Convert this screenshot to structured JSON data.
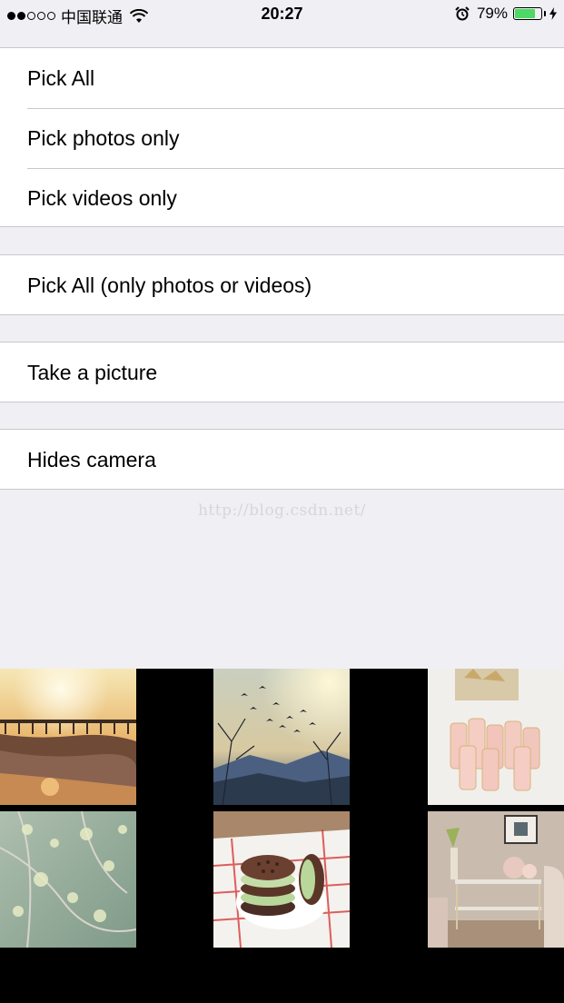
{
  "status_bar": {
    "carrier": "中国联通",
    "time": "20:27",
    "battery_percent": "79%",
    "battery_level": 0.79,
    "signal_bars_filled": 2,
    "signal_bars_total": 5
  },
  "menu": {
    "group1": {
      "pick_all": "Pick All",
      "pick_photos_only": "Pick photos only",
      "pick_videos_only": "Pick videos only"
    },
    "group2": {
      "pick_all_exclusive": "Pick All (only photos or videos)"
    },
    "group3": {
      "take_picture": "Take a picture"
    },
    "group4": {
      "hides_camera": "Hides camera"
    }
  },
  "watermark": "http://blog.csdn.net/",
  "photos": [
    {
      "subject": "sunset-pier"
    },
    {
      "subject": "birds-sky"
    },
    {
      "subject": "champagne-glasses"
    },
    {
      "subject": "blossom-branches"
    },
    {
      "subject": "ice-cream-sandwich"
    },
    {
      "subject": "living-room"
    }
  ],
  "colors": {
    "background": "#efeff4",
    "separator": "#c8c7cc",
    "battery_green": "#4cd964"
  }
}
